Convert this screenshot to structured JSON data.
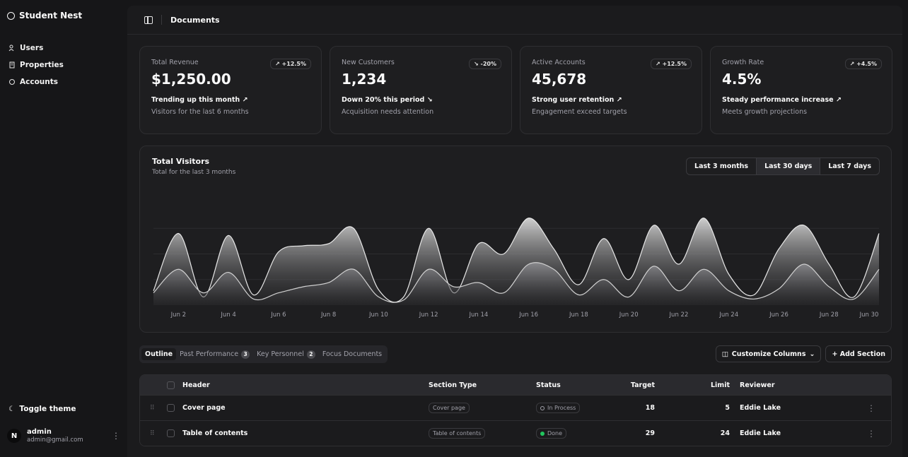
{
  "sidebar": {
    "brand": "Student Nest",
    "items": [
      {
        "label": "Users",
        "icon": "users-icon"
      },
      {
        "label": "Properties",
        "icon": "building-icon"
      },
      {
        "label": "Accounts",
        "icon": "account-icon"
      }
    ],
    "toggle_theme": "Toggle theme",
    "user": {
      "initial": "N",
      "name": "admin",
      "email": "admin@gmail.com"
    }
  },
  "header": {
    "title": "Documents"
  },
  "cards": [
    {
      "label": "Total Revenue",
      "value": "$1,250.00",
      "badge": "↗ +12.5%",
      "trend": "Trending up this month ↗",
      "sub": "Visitors for the last 6 months"
    },
    {
      "label": "New Customers",
      "value": "1,234",
      "badge": "↘ -20%",
      "trend": "Down 20% this period ↘",
      "sub": "Acquisition needs attention"
    },
    {
      "label": "Active Accounts",
      "value": "45,678",
      "badge": "↗ +12.5%",
      "trend": "Strong user retention ↗",
      "sub": "Engagement exceed targets"
    },
    {
      "label": "Growth Rate",
      "value": "4.5%",
      "badge": "↗ +4.5%",
      "trend": "Steady performance increase ↗",
      "sub": "Meets growth projections"
    }
  ],
  "chart": {
    "title": "Total Visitors",
    "subtitle": "Total for the last 3 months",
    "ranges": [
      "Last 3 months",
      "Last 30 days",
      "Last 7 days"
    ],
    "active_range": "Last 30 days"
  },
  "chart_data": {
    "type": "area",
    "x": [
      "Jun 1",
      "Jun 2",
      "Jun 3",
      "Jun 4",
      "Jun 5",
      "Jun 6",
      "Jun 7",
      "Jun 8",
      "Jun 9",
      "Jun 10",
      "Jun 11",
      "Jun 12",
      "Jun 13",
      "Jun 14",
      "Jun 15",
      "Jun 16",
      "Jun 17",
      "Jun 18",
      "Jun 19",
      "Jun 20",
      "Jun 21",
      "Jun 22",
      "Jun 23",
      "Jun 24",
      "Jun 25",
      "Jun 26",
      "Jun 27",
      "Jun 28",
      "Jun 29",
      "Jun 30"
    ],
    "tick_labels": [
      "Jun 2",
      "Jun 4",
      "Jun 6",
      "Jun 8",
      "Jun 10",
      "Jun 12",
      "Jun 14",
      "Jun 16",
      "Jun 18",
      "Jun 20",
      "Jun 22",
      "Jun 24",
      "Jun 26",
      "Jun 28",
      "Jun 30"
    ],
    "series": [
      {
        "values": [
          14,
          70,
          8,
          68,
          10,
          52,
          58,
          60,
          75,
          15,
          8,
          75,
          12,
          60,
          50,
          85,
          55,
          20,
          65,
          25,
          78,
          40,
          85,
          30,
          10,
          55,
          78,
          40,
          8,
          70
        ]
      },
      {
        "values": [
          12,
          35,
          12,
          32,
          6,
          12,
          18,
          22,
          35,
          8,
          5,
          35,
          18,
          22,
          12,
          40,
          35,
          10,
          25,
          8,
          38,
          14,
          35,
          14,
          6,
          16,
          40,
          18,
          6,
          35
        ]
      }
    ],
    "ylim": [
      0,
      100
    ],
    "grid": true,
    "legend": "none"
  },
  "tabs": [
    {
      "label": "Outline",
      "count": ""
    },
    {
      "label": "Past Performance",
      "count": "3"
    },
    {
      "label": "Key Personnel",
      "count": "2"
    },
    {
      "label": "Focus Documents",
      "count": ""
    }
  ],
  "actions": {
    "customize": "Customize Columns",
    "add": "+ Add Section"
  },
  "table": {
    "columns": {
      "header": "Header",
      "type": "Section Type",
      "status": "Status",
      "target": "Target",
      "limit": "Limit",
      "reviewer": "Reviewer"
    },
    "rows": [
      {
        "header": "Cover page",
        "type": "Cover page",
        "status": "In Process",
        "target": "18",
        "limit": "5",
        "reviewer": "Eddie Lake"
      },
      {
        "header": "Table of contents",
        "type": "Table of contents",
        "status": "Done",
        "target": "29",
        "limit": "24",
        "reviewer": "Eddie Lake"
      }
    ],
    "done_color": "#22c55e"
  }
}
